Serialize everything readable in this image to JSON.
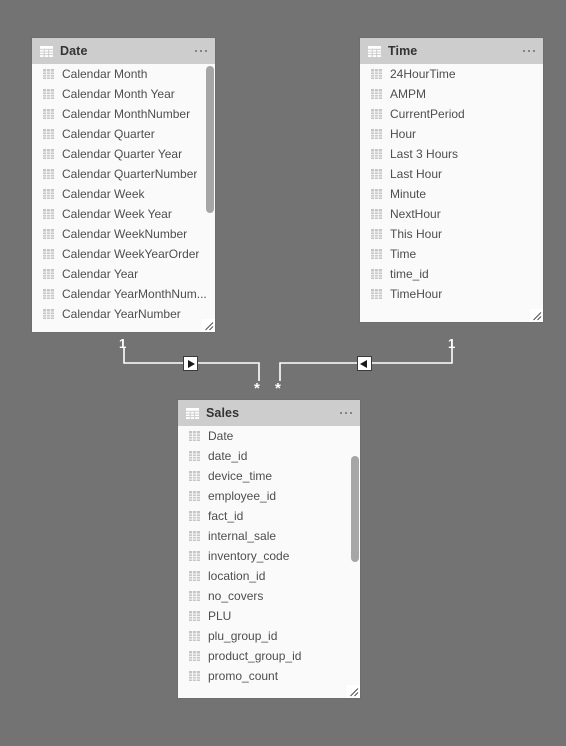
{
  "canvas": {
    "background": "#737373",
    "surface_color": "#fafafa",
    "header_color": "#cdcdcd",
    "relationship_line_color": "#ffffff"
  },
  "tables": [
    {
      "id": "date",
      "name": "Date",
      "header_icon": "table-grid-icon",
      "menu_label": "more-options",
      "fields": [
        "Calendar Month",
        "Calendar Month Year",
        "Calendar MonthNumber",
        "Calendar Quarter",
        "Calendar Quarter Year",
        "Calendar QuarterNumber",
        "Calendar Week",
        "Calendar Week Year",
        "Calendar WeekNumber",
        "Calendar WeekYearOrder",
        "Calendar Year",
        "Calendar YearMonthNum...",
        "Calendar YearNumber"
      ],
      "scroll_visible": true
    },
    {
      "id": "time",
      "name": "Time",
      "header_icon": "table-grid-icon",
      "menu_label": "more-options",
      "fields": [
        "24HourTime",
        "AMPM",
        "CurrentPeriod",
        "Hour",
        "Last 3 Hours",
        "Last Hour",
        "Minute",
        "NextHour",
        "This Hour",
        "Time",
        "time_id",
        "TimeHour"
      ],
      "scroll_visible": false
    },
    {
      "id": "sales",
      "name": "Sales",
      "header_icon": "table-grid-icon",
      "menu_label": "more-options",
      "fields": [
        "Date",
        "date_id",
        "device_time",
        "employee_id",
        "fact_id",
        "internal_sale",
        "inventory_code",
        "location_id",
        "no_covers",
        "PLU",
        "plu_group_id",
        "product_group_id",
        "promo_count"
      ],
      "scroll_visible": true
    }
  ],
  "relationships": [
    {
      "id": "date-sales",
      "from_table": "Date",
      "to_table": "Sales",
      "from_cardinality": "1",
      "to_cardinality": "*",
      "cross_filter_direction": "single",
      "marker": "arrow-right-icon"
    },
    {
      "id": "time-sales",
      "from_table": "Time",
      "to_table": "Sales",
      "from_cardinality": "1",
      "to_cardinality": "*",
      "cross_filter_direction": "single",
      "marker": "arrow-left-icon"
    }
  ]
}
